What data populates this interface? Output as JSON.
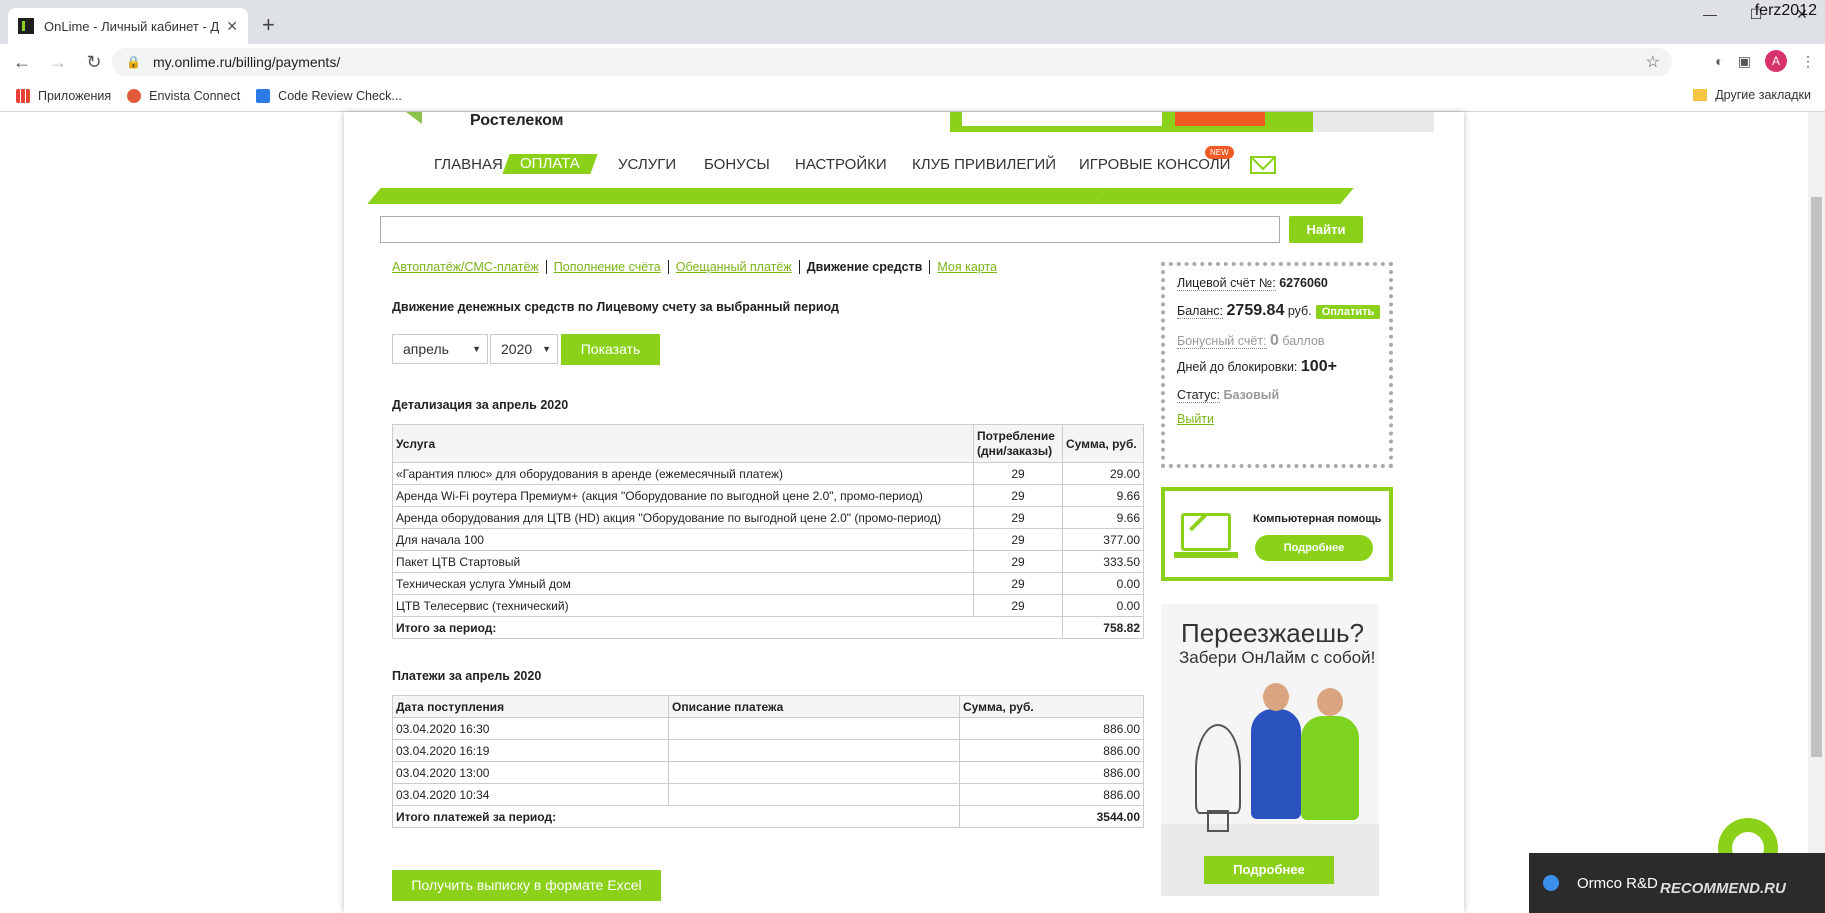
{
  "browser": {
    "tab_title": "OnLime - Личный кабинет - Дв",
    "url": "my.onlime.ru/billing/payments/",
    "user": "ferz2012",
    "avatar_letter": "A",
    "bookmarks": [
      "Приложения",
      "Envista Connect",
      "Code Review Check..."
    ],
    "other_bookmarks": "Другие закладки"
  },
  "site": {
    "logo_text": "Ростелеком",
    "nav": [
      "ГЛАВНАЯ",
      "ОПЛАТА",
      "УСЛУГИ",
      "БОНУСЫ",
      "НАСТРОЙКИ",
      "КЛУБ ПРИВИЛЕГИЙ",
      "ИГРОВЫЕ КОНСОЛИ"
    ],
    "nav_new_badge": "NEW",
    "search_button": "Найти",
    "subnav": [
      "Автоплатёж/СМС-платёж",
      "Пополнение счёта",
      "Обещанный платёж",
      "Движение средств",
      "Моя карта"
    ]
  },
  "main": {
    "heading": "Движение денежных средств по Лицевому счету за выбранный период",
    "month": "апрель",
    "year": "2020",
    "show_button": "Показать",
    "detail_title": "Детализация за апрель 2020",
    "detail_headers": [
      "Услуга",
      "Потребление (дни/заказы)",
      "Сумма, руб."
    ],
    "detail_rows": [
      [
        "«Гарантия плюс» для оборудования в аренде (ежемесячный платеж)",
        "29",
        "29.00"
      ],
      [
        "Аренда Wi-Fi роутера Премиум+ (акция \"Оборудование по выгодной цене 2.0\", промо-период)",
        "29",
        "9.66"
      ],
      [
        "Аренда оборудования для ЦТВ (HD) акция \"Оборудование по выгодной цене 2.0\" (промо-период)",
        "29",
        "9.66"
      ],
      [
        "Для начала 100",
        "29",
        "377.00"
      ],
      [
        "Пакет ЦТВ Стартовый",
        "29",
        "333.50"
      ],
      [
        "Техническая услуга Умный дом",
        "29",
        "0.00"
      ],
      [
        "ЦТВ Телесервис (технический)",
        "29",
        "0.00"
      ]
    ],
    "detail_total_label": "Итого за период:",
    "detail_total": "758.82",
    "payments_title": "Платежи за апрель 2020",
    "payments_headers": [
      "Дата поступления",
      "Описание платежа",
      "Сумма, руб."
    ],
    "payments_rows": [
      [
        "03.04.2020 16:30",
        "",
        "886.00"
      ],
      [
        "03.04.2020 16:19",
        "",
        "886.00"
      ],
      [
        "03.04.2020 13:00",
        "",
        "886.00"
      ],
      [
        "03.04.2020 10:34",
        "",
        "886.00"
      ]
    ],
    "payments_total_label": "Итого платежей за период:",
    "payments_total": "3544.00",
    "excel_button": "Получить выписку в формате Excel"
  },
  "account": {
    "account_label": "Лицевой счёт №:",
    "account_number": "6276060",
    "balance_label": "Баланс:",
    "balance_value": "2759.84",
    "balance_unit": "руб.",
    "pay_button": "Оплатить",
    "bonus_label": "Бонусный счёт:",
    "bonus_value": "0",
    "bonus_unit": "баллов",
    "days_label": "Дней до блокировки:",
    "days_value": "100+",
    "status_label": "Статус:",
    "status_value": "Базовый",
    "logout": "Выйти"
  },
  "help": {
    "title": "Компьютерная помощь",
    "button": "Подробнее"
  },
  "promo": {
    "title": "Переезжаешь?",
    "subtitle": "Забери ОнЛайм с собой!",
    "button": "Подробнее"
  },
  "notification": {
    "text": "Ormco R&D"
  },
  "watermark": "RECOMMEND.RU"
}
